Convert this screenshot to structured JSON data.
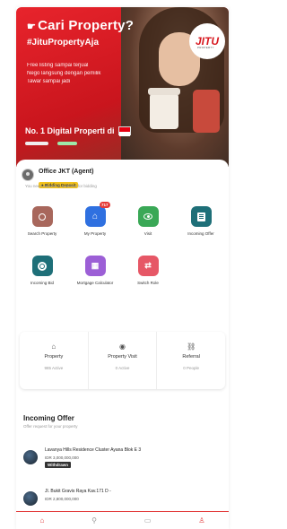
{
  "hero": {
    "title": "Cari Property?",
    "hashtag": "#JituPropertyAja",
    "lines": [
      "Free listing sampai terjual",
      "Nego langsung dengan pemilik",
      "Tawar sampai jadi"
    ],
    "bottom_text": "No. 1 Digital Properti di",
    "logo_text": "JITU",
    "logo_sub": "PROPERTY"
  },
  "office": {
    "name": "Office JKT (Agent)",
    "deposit_badge": "Bidding Deposit",
    "deposit_note": "You need deposit to qualified for bidding"
  },
  "menu": [
    {
      "label": "Search Property",
      "icon": "search-icon",
      "color": "#a8675c",
      "badge": ""
    },
    {
      "label": "My Property",
      "icon": "home-icon",
      "color": "#2f70e0",
      "badge": "717"
    },
    {
      "label": "Visit",
      "icon": "eye-icon",
      "color": "#3aa856",
      "badge": ""
    },
    {
      "label": "Incoming Offer",
      "icon": "document-icon",
      "color": "#1e6f78",
      "badge": ""
    },
    {
      "label": "Incoming Bid",
      "icon": "target-icon",
      "color": "#1e6f78",
      "badge": ""
    },
    {
      "label": "Mortgage Calculator",
      "icon": "calculator-icon",
      "color": "#9c5fd6",
      "badge": ""
    },
    {
      "label": "Switch Role",
      "icon": "switch-icon",
      "color": "#e65766",
      "badge": ""
    }
  ],
  "stats": [
    {
      "title": "Property",
      "sub": "985 Active",
      "icon": "home-icon"
    },
    {
      "title": "Property Visit",
      "sub": "0 Active",
      "icon": "eye-icon"
    },
    {
      "title": "Referral",
      "sub": "0 People",
      "icon": "link-icon"
    }
  ],
  "incoming": {
    "title": "Incoming Offer",
    "subtitle": "Offer request for your property",
    "offers": [
      {
        "title": "Lavanya Hills Residence Cluster Ayana Blok E 3",
        "price": "IDR 3,000,000,000",
        "status": "Withdrawn"
      },
      {
        "title": "Jl. Bukit Gravis Raya Kav.171 D -",
        "price": "IDR 2,800,000,000",
        "status": ""
      }
    ]
  },
  "nav": [
    {
      "icon": "home-icon",
      "active": true
    },
    {
      "icon": "search-icon",
      "active": false
    },
    {
      "icon": "chat-icon",
      "active": false
    },
    {
      "icon": "profile-icon",
      "active": false
    }
  ]
}
